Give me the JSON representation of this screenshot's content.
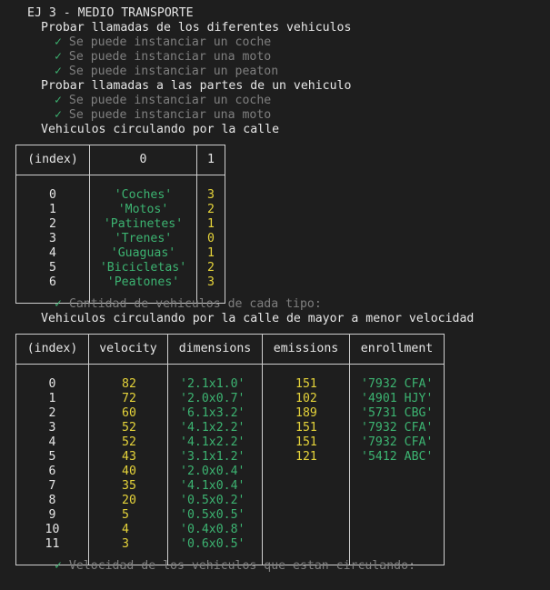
{
  "lines": {
    "title": "EJ 3 - MEDIO TRANSPORTE",
    "g1": "Probar llamadas de los diferentes vehiculos",
    "g1_t1": "Se puede instanciar un coche",
    "g1_t2": "Se puede instanciar una moto",
    "g1_t3": "Se puede instanciar un peaton",
    "g2": "Probar llamadas a las partes de un vehiculo",
    "g2_t1": "Se puede instanciar un coche",
    "g2_t2": "Se puede instanciar una moto",
    "g3": "Vehiculos circulando por la calle",
    "g3_t1": "Cantidad de vehiculos de cada tipo:",
    "g4": "Vehiculos circulando por la calle de mayor a menor velocidad",
    "g4_t1": "Velocidad de los vehiculos que estan circulando:"
  },
  "check_symbol": "✓",
  "colors": {
    "background": "#1e1e1e",
    "check": "#3cb371",
    "passed_text": "#7f7f7f",
    "string": "#3cb371",
    "number": "#e5d33a",
    "border": "#cfcfcf"
  },
  "table1": {
    "headers": [
      "(index)",
      "0",
      "1"
    ],
    "rows": [
      {
        "index": "0",
        "c0": "'Coches'",
        "c1": "3"
      },
      {
        "index": "1",
        "c0": "'Motos'",
        "c1": "2"
      },
      {
        "index": "2",
        "c0": "'Patinetes'",
        "c1": "1"
      },
      {
        "index": "3",
        "c0": "'Trenes'",
        "c1": "0"
      },
      {
        "index": "4",
        "c0": "'Guaguas'",
        "c1": "1"
      },
      {
        "index": "5",
        "c0": "'Bicicletas'",
        "c1": "2"
      },
      {
        "index": "6",
        "c0": "'Peatones'",
        "c1": "3"
      }
    ]
  },
  "table2": {
    "headers": [
      "(index)",
      "velocity",
      "dimensions",
      "emissions",
      "enrollment"
    ],
    "rows": [
      {
        "index": "0",
        "velocity": "82",
        "dimensions": "'2.1x1.0'",
        "emissions": "151",
        "enrollment": "'7932 CFA'"
      },
      {
        "index": "1",
        "velocity": "72",
        "dimensions": "'2.0x0.7'",
        "emissions": "102",
        "enrollment": "'4901 HJY'"
      },
      {
        "index": "2",
        "velocity": "60",
        "dimensions": "'6.1x3.2'",
        "emissions": "189",
        "enrollment": "'5731 CBG'"
      },
      {
        "index": "3",
        "velocity": "52",
        "dimensions": "'4.1x2.2'",
        "emissions": "151",
        "enrollment": "'7932 CFA'"
      },
      {
        "index": "4",
        "velocity": "52",
        "dimensions": "'4.1x2.2'",
        "emissions": "151",
        "enrollment": "'7932 CFA'"
      },
      {
        "index": "5",
        "velocity": "43",
        "dimensions": "'3.1x1.2'",
        "emissions": "121",
        "enrollment": "'5412 ABC'"
      },
      {
        "index": "6",
        "velocity": "40",
        "dimensions": "'2.0x0.4'",
        "emissions": "",
        "enrollment": ""
      },
      {
        "index": "7",
        "velocity": "35",
        "dimensions": "'4.1x0.4'",
        "emissions": "",
        "enrollment": ""
      },
      {
        "index": "8",
        "velocity": "20",
        "dimensions": "'0.5x0.2'",
        "emissions": "",
        "enrollment": ""
      },
      {
        "index": "9",
        "velocity": "5",
        "dimensions": "'0.5x0.5'",
        "emissions": "",
        "enrollment": ""
      },
      {
        "index": "10",
        "velocity": "4",
        "dimensions": "'0.4x0.8'",
        "emissions": "",
        "enrollment": ""
      },
      {
        "index": "11",
        "velocity": "3",
        "dimensions": "'0.6x0.5'",
        "emissions": "",
        "enrollment": ""
      }
    ]
  }
}
